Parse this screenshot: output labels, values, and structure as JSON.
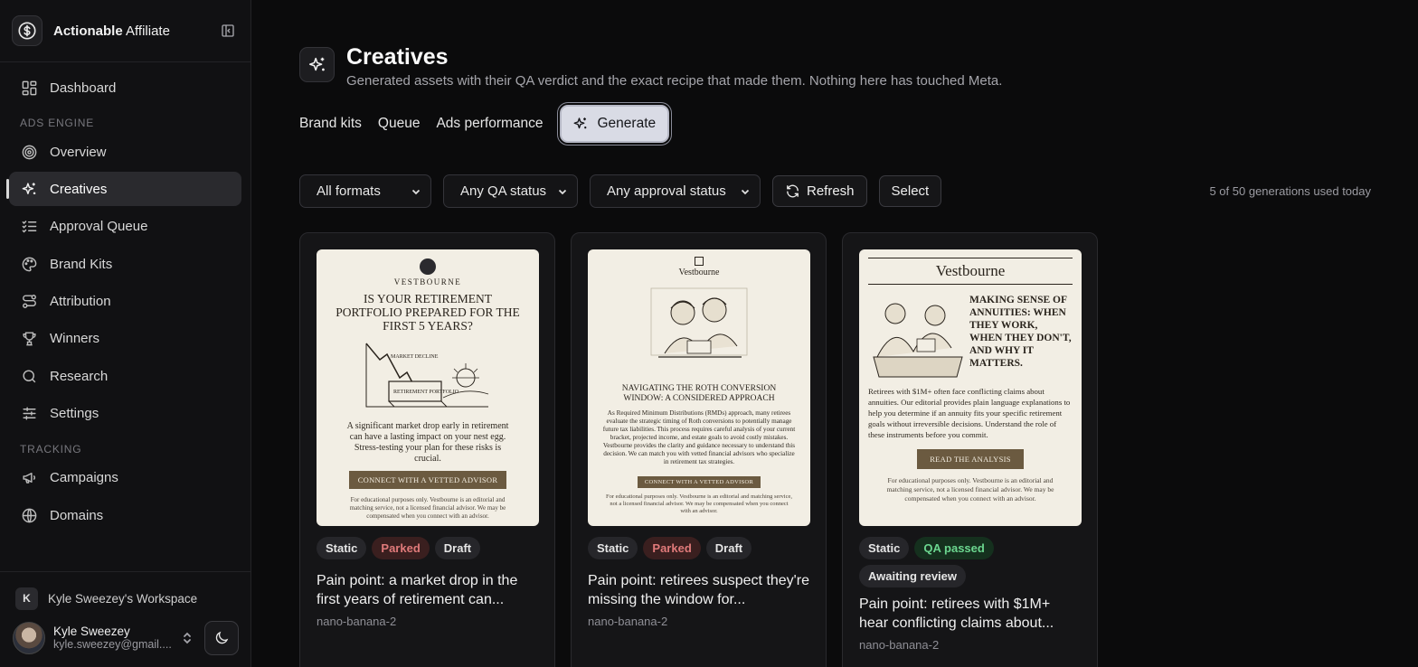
{
  "brand": {
    "name_bold": "Actionable",
    "name_light": " Affiliate"
  },
  "nav": {
    "dashboard": "Dashboard",
    "section_ads": "ADS ENGINE",
    "overview": "Overview",
    "creatives": "Creatives",
    "approval_queue": "Approval Queue",
    "brand_kits": "Brand Kits",
    "attribution": "Attribution",
    "winners": "Winners",
    "research": "Research",
    "settings": "Settings",
    "section_tracking": "TRACKING",
    "campaigns": "Campaigns",
    "domains": "Domains"
  },
  "workspace": {
    "initial": "K",
    "name": "Kyle Sweezey's Workspace"
  },
  "user": {
    "name": "Kyle Sweezey",
    "email": "kyle.sweezey@gmail...."
  },
  "page": {
    "title": "Creatives",
    "subtitle": "Generated assets with their QA verdict and the exact recipe that made them. Nothing here has touched Meta."
  },
  "tabs": {
    "brand_kits": "Brand kits",
    "queue": "Queue",
    "ads_performance": "Ads performance",
    "generate": "Generate"
  },
  "filters": {
    "format": "All formats",
    "qa_status": "Any QA status",
    "approval_status": "Any approval status",
    "refresh": "Refresh",
    "select": "Select",
    "usage": "5 of 50 generations used today"
  },
  "cards": [
    {
      "badges": [
        "Static",
        "Parked",
        "Draft"
      ],
      "title": "Pain point: a market drop in the first years of retirement can...",
      "model": "nano-banana-2",
      "thumb": {
        "brand": "VESTBOURNE",
        "headline": "IS YOUR RETIREMENT PORTFOLIO PREPARED FOR THE FIRST 5 YEARS?",
        "illus_top": "MARKET DECLINE",
        "illus_label": "RETIREMENT PORTFOLIO",
        "body": "A significant market drop early in retirement can have a lasting impact on your nest egg. Stress-testing your plan for these risks is crucial.",
        "cta": "CONNECT WITH A VETTED ADVISOR",
        "footer": "For educational purposes only. Vestbourne is an editorial and matching service, not a licensed financial advisor. We may be compensated when you connect with an advisor."
      }
    },
    {
      "badges": [
        "Static",
        "Parked",
        "Draft"
      ],
      "title": "Pain point: retirees suspect they're missing the window for...",
      "model": "nano-banana-2",
      "thumb": {
        "brand": "Vestbourne",
        "headline": "NAVIGATING THE ROTH CONVERSION WINDOW: A CONSIDERED APPROACH",
        "body": "As Required Minimum Distributions (RMDs) approach, many retirees evaluate the strategic timing of Roth conversions to potentially manage future tax liabilities. This process requires careful analysis of your current bracket, projected income, and estate goals to avoid costly mistakes. Vestbourne provides the clarity and guidance necessary to understand this decision. We can match you with vetted financial advisors who specialize in retirement tax strategies.",
        "cta": "CONNECT WITH A VETTED ADVISOR",
        "footer": "For educational purposes only. Vestbourne is an editorial and matching service, not a licensed financial advisor. We may be compensated when you connect with an advisor."
      }
    },
    {
      "badges": [
        "Static",
        "QA passed",
        "Awaiting review"
      ],
      "title": "Pain point: retirees with $1M+ hear conflicting claims about...",
      "model": "nano-banana-2",
      "thumb": {
        "brand": "Vestbourne",
        "headline": "MAKING SENSE OF ANNUITIES: WHEN THEY WORK, WHEN THEY DON'T, AND WHY IT MATTERS.",
        "body": "Retirees with $1M+ often face conflicting claims about annuities. Our editorial provides plain language explanations to help you determine if an annuity fits your specific retirement goals without irreversible decisions. Understand the role of these instruments before you commit.",
        "cta": "READ THE ANALYSIS",
        "footer": "For educational purposes only. Vestbourne is an editorial and matching service, not a licensed financial advisor. We may be compensated when you connect with an advisor."
      }
    }
  ]
}
